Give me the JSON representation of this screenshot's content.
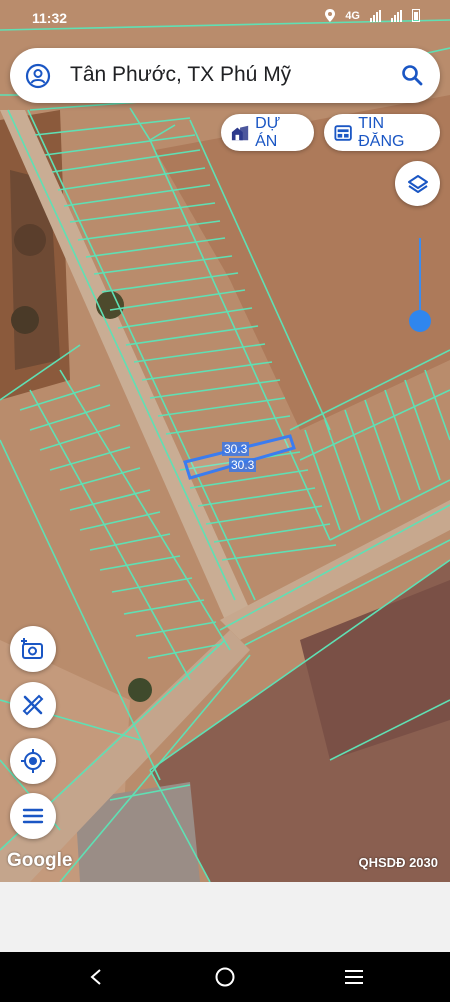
{
  "status": {
    "time": "11:32",
    "network": "4G"
  },
  "search": {
    "query": "Tân Phước, TX Phú Mỹ"
  },
  "chips": {
    "du_an": "DỰ ÁN",
    "tin_dang": "TIN ĐĂNG"
  },
  "map": {
    "measure_top": "30.3",
    "measure_bottom": "30.3",
    "attribution": "Google",
    "layer_label": "QHSDĐ 2030"
  },
  "colors": {
    "accent": "#1a56c4",
    "parcel_line": "#5fe0b4",
    "road": "#9e9e88",
    "terrain": "#b98c6c"
  }
}
